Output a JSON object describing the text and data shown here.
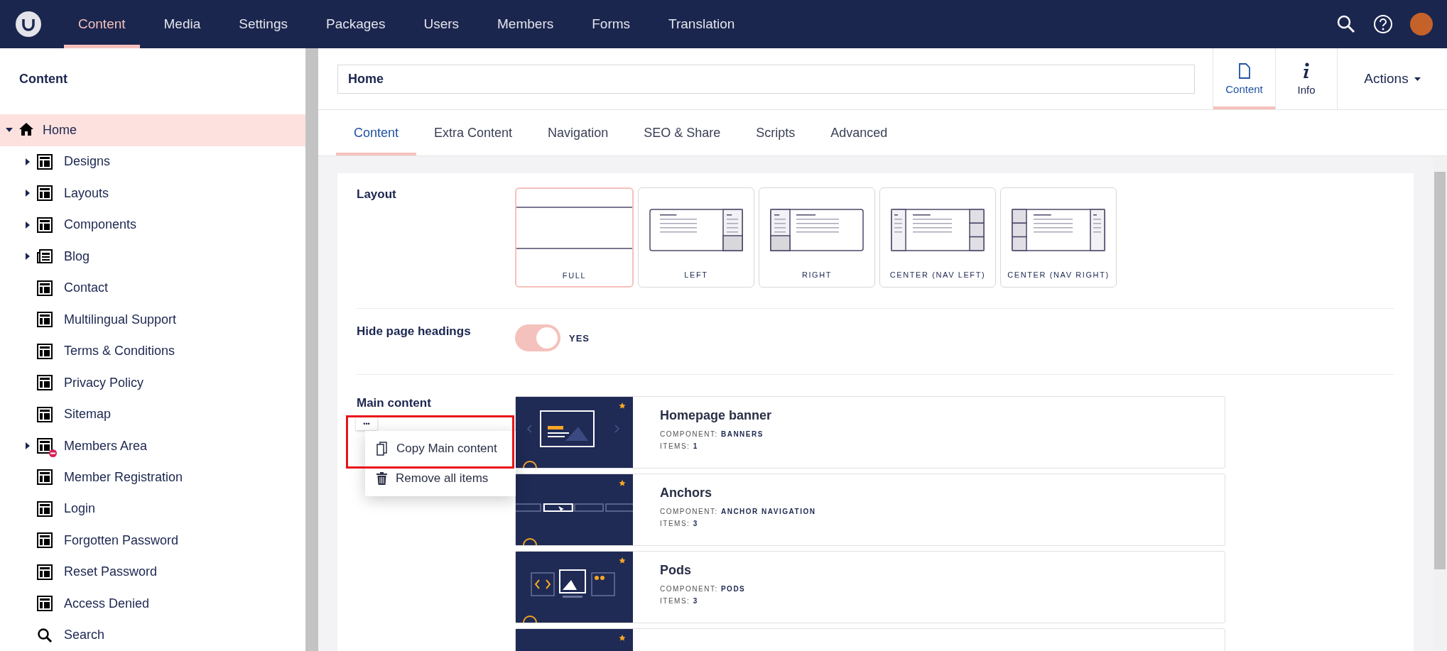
{
  "topbar": {
    "nav": [
      {
        "label": "Content",
        "selected": true
      },
      {
        "label": "Media",
        "selected": false
      },
      {
        "label": "Settings",
        "selected": false
      },
      {
        "label": "Packages",
        "selected": false
      },
      {
        "label": "Users",
        "selected": false
      },
      {
        "label": "Members",
        "selected": false
      },
      {
        "label": "Forms",
        "selected": false
      },
      {
        "label": "Translation",
        "selected": false
      }
    ]
  },
  "sidebar": {
    "title": "Content",
    "tree": [
      {
        "label": "Home",
        "kind": "home",
        "selected": true,
        "expanded": true,
        "children": [
          {
            "label": "Designs",
            "kind": "page",
            "selected": false,
            "expandable": true,
            "expanded": false
          },
          {
            "label": "Layouts",
            "kind": "page",
            "selected": false,
            "expandable": true,
            "expanded": false
          },
          {
            "label": "Components",
            "kind": "page",
            "selected": false,
            "expandable": true,
            "expanded": false
          },
          {
            "label": "Blog",
            "kind": "blog",
            "selected": false,
            "expandable": true,
            "expanded": false
          },
          {
            "label": "Contact",
            "kind": "page",
            "selected": false,
            "expandable": false
          },
          {
            "label": "Multilingual Support",
            "kind": "page",
            "selected": false,
            "expandable": false
          },
          {
            "label": "Terms & Conditions",
            "kind": "page",
            "selected": false,
            "expandable": false
          },
          {
            "label": "Privacy Policy",
            "kind": "page",
            "selected": false,
            "expandable": false
          },
          {
            "label": "Sitemap",
            "kind": "page",
            "selected": false,
            "expandable": false
          },
          {
            "label": "Members Area",
            "kind": "page",
            "selected": false,
            "expandable": true,
            "expanded": false,
            "protected": true
          },
          {
            "label": "Member Registration",
            "kind": "page",
            "selected": false,
            "expandable": false
          },
          {
            "label": "Login",
            "kind": "page",
            "selected": false,
            "expandable": false
          },
          {
            "label": "Forgotten Password",
            "kind": "page",
            "selected": false,
            "expandable": false
          },
          {
            "label": "Reset Password",
            "kind": "page",
            "selected": false,
            "expandable": false
          },
          {
            "label": "Access Denied",
            "kind": "page",
            "selected": false,
            "expandable": false
          },
          {
            "label": "Search",
            "kind": "search",
            "selected": false,
            "expandable": false
          }
        ]
      }
    ]
  },
  "editor": {
    "name": "Home",
    "apps": [
      {
        "label": "Content",
        "kind": "document",
        "selected": true
      },
      {
        "label": "Info",
        "kind": "info",
        "selected": false
      }
    ],
    "actions": "Actions",
    "tabs": [
      {
        "label": "Content",
        "selected": true
      },
      {
        "label": "Extra Content",
        "selected": false
      },
      {
        "label": "Navigation",
        "selected": false
      },
      {
        "label": "SEO & Share",
        "selected": false
      },
      {
        "label": "Scripts",
        "selected": false
      },
      {
        "label": "Advanced",
        "selected": false
      }
    ],
    "layout": {
      "label": "Layout",
      "options": [
        {
          "label": "FULL",
          "kind": "full",
          "selected": true
        },
        {
          "label": "LEFT",
          "kind": "left",
          "selected": false
        },
        {
          "label": "RIGHT",
          "kind": "right",
          "selected": false
        },
        {
          "label": "CENTER (NAV LEFT)",
          "kind": "center-left",
          "selected": false
        },
        {
          "label": "CENTER (NAV RIGHT)",
          "kind": "center-right",
          "selected": false
        }
      ]
    },
    "hide_headings": {
      "label": "Hide page headings",
      "on": true,
      "text": "YES"
    },
    "main_content": {
      "label": "Main content",
      "menu": {
        "button": "•••",
        "highlighted": true,
        "items": [
          {
            "label": "Copy Main content",
            "kind": "copy"
          },
          {
            "label": "Remove all items",
            "kind": "delete"
          }
        ]
      },
      "blocks": [
        {
          "kind": "banner",
          "title": "Homepage banner",
          "component_label": "COMPONENT:",
          "component": "BANNERS",
          "items_label": "ITEMS:",
          "items": "1"
        },
        {
          "kind": "anchors",
          "title": "Anchors",
          "component_label": "COMPONENT:",
          "component": "ANCHOR NAVIGATION",
          "items_label": "ITEMS:",
          "items": "3"
        },
        {
          "kind": "pods",
          "title": "Pods",
          "component_label": "COMPONENT:",
          "component": "PODS",
          "items_label": "ITEMS:",
          "items": "3"
        },
        {
          "kind": "generic"
        }
      ]
    }
  }
}
